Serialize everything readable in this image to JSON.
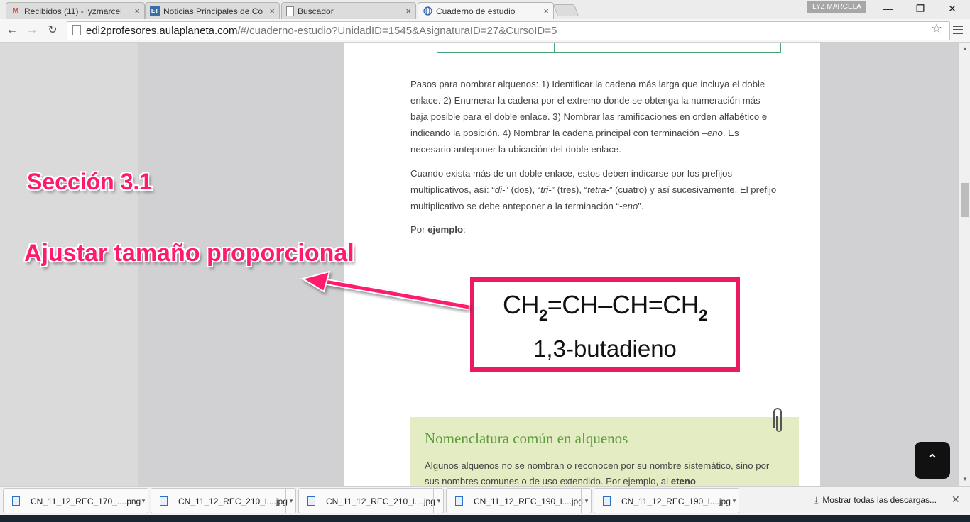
{
  "browser": {
    "tabs": [
      {
        "label": "Recibidos (11) - lyzmarcel",
        "icon": "gmail-icon",
        "glyph": "M",
        "color": "#d34836"
      },
      {
        "label": "Noticias Principales de Co",
        "icon": "news-icon",
        "glyph": "ET",
        "color": "#3b6ea5"
      },
      {
        "label": "Buscador",
        "icon": "page-icon",
        "glyph": "",
        "color": "#888888"
      },
      {
        "label": "Cuaderno de estudio",
        "icon": "globe-icon",
        "glyph": "",
        "color": "#2a5db0"
      }
    ],
    "close_glyph": "×",
    "user_name": "LYZ MARCELA",
    "window": {
      "minimize": "—",
      "maximize": "❐",
      "close": "✕"
    },
    "nav": {
      "back": "←",
      "forward": "→",
      "reload": "↻"
    },
    "url_host": "edi2profesores.aulaplaneta.com",
    "url_path": "/#/cuaderno-estudio?UnidadID=1545&AsignaturaID=27&CursoID=5",
    "star_glyph": "☆"
  },
  "content": {
    "paragraph1_parts": [
      "Pasos para nombrar alquenos: 1) Identificar la cadena más larga que incluya el doble enlace. 2) Enumerar la cadena por el extremo donde se obtenga la numeración más baja posible para el doble enlace. 3) Nombrar las ramificaciones en orden alfabético e indicando la posición. 4) Nombrar la cadena principal con terminación –",
      "eno",
      ". Es necesario anteponer la ubicación del doble enlace."
    ],
    "paragraph2_parts": [
      "Cuando exista más de un doble enlace, estos deben indicarse por los prefijos multiplicativos, así: “",
      "di-",
      "” (dos), “",
      "tri-",
      "” (tres), “",
      "tetra-",
      "” (cuatro) y así sucesivamente. El prefijo multiplicativo se debe anteponer a la terminación “",
      "-eno",
      "”."
    ],
    "example_prefix": "Por ",
    "example_bold": "ejemplo",
    "example_suffix": ":",
    "formula_parts": [
      "CH",
      "2",
      "=CH–CH=CH",
      "2"
    ],
    "formula_name": "1,3-butadieno",
    "green_box_title": "Nomenclatura común en alquenos",
    "green_box_text": "Algunos alquenos no se nombran o reconocen por su nombre sistemático, sino por sus nombres comunes o de uso extendido. Por ejemplo, al ",
    "green_box_bold": "eteno",
    "scroll_top_glyph": "⌃"
  },
  "annotations": {
    "section": "Sección 3.1",
    "instruction": "Ajustar tamaño proporcional",
    "color": "#ff1a6e"
  },
  "downloads": {
    "items": [
      {
        "name": "CN_11_12_REC_170_....png"
      },
      {
        "name": "CN_11_12_REC_210_l....jpg"
      },
      {
        "name": "CN_11_12_REC_210_l....jpg"
      },
      {
        "name": "CN_11_12_REC_190_l....jpg"
      },
      {
        "name": "CN_11_12_REC_190_l....jpg"
      }
    ],
    "dropdown_glyph": "▾",
    "show_all": "Mostrar todas las descargas...",
    "close_glyph": "✕"
  }
}
